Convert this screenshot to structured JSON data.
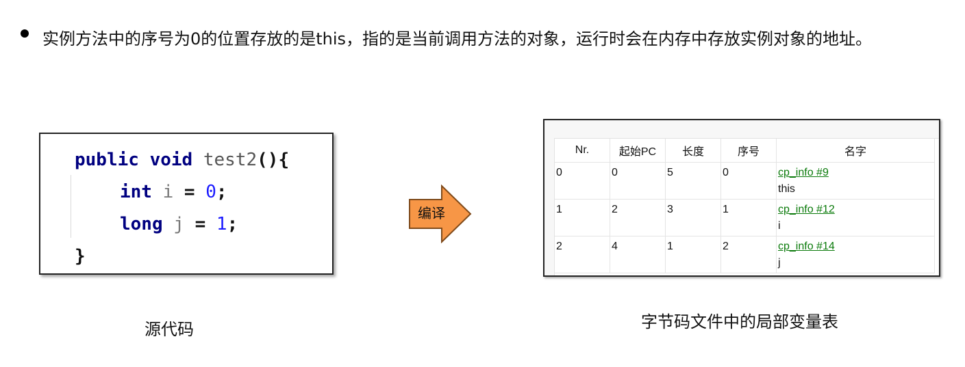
{
  "intro": {
    "text": "实例方法中的序号为0的位置存放的是this，指的是当前调用方法的对象，运行时会在内存中存放实例对象的地址。"
  },
  "source_code": {
    "line1": {
      "kw1": "public",
      "kw2": "void",
      "name": "test2",
      "tail": "(){"
    },
    "line2": {
      "kw": "int",
      "var": "i",
      "eq": " = ",
      "val": "0",
      "end": ";"
    },
    "line3": {
      "kw": "long",
      "var": "j",
      "eq": " = ",
      "val": "1",
      "end": ";"
    },
    "line4": {
      "brace": "}"
    }
  },
  "arrow": {
    "label": "编译",
    "fill_color": "#F79646",
    "stroke_color": "#7F4A1A"
  },
  "local_variable_table": {
    "headers": [
      "Nr.",
      "起始PC",
      "长度",
      "序号",
      "名字"
    ],
    "rows": [
      {
        "nr": "0",
        "start_pc": "0",
        "length": "5",
        "index": "0",
        "ref": "cp_info #9",
        "name": "this"
      },
      {
        "nr": "1",
        "start_pc": "2",
        "length": "3",
        "index": "1",
        "ref": "cp_info #12",
        "name": "i"
      },
      {
        "nr": "2",
        "start_pc": "4",
        "length": "1",
        "index": "2",
        "ref": "cp_info #14",
        "name": "j"
      }
    ]
  },
  "captions": {
    "source": "源代码",
    "table": "字节码文件中的局部变量表"
  }
}
